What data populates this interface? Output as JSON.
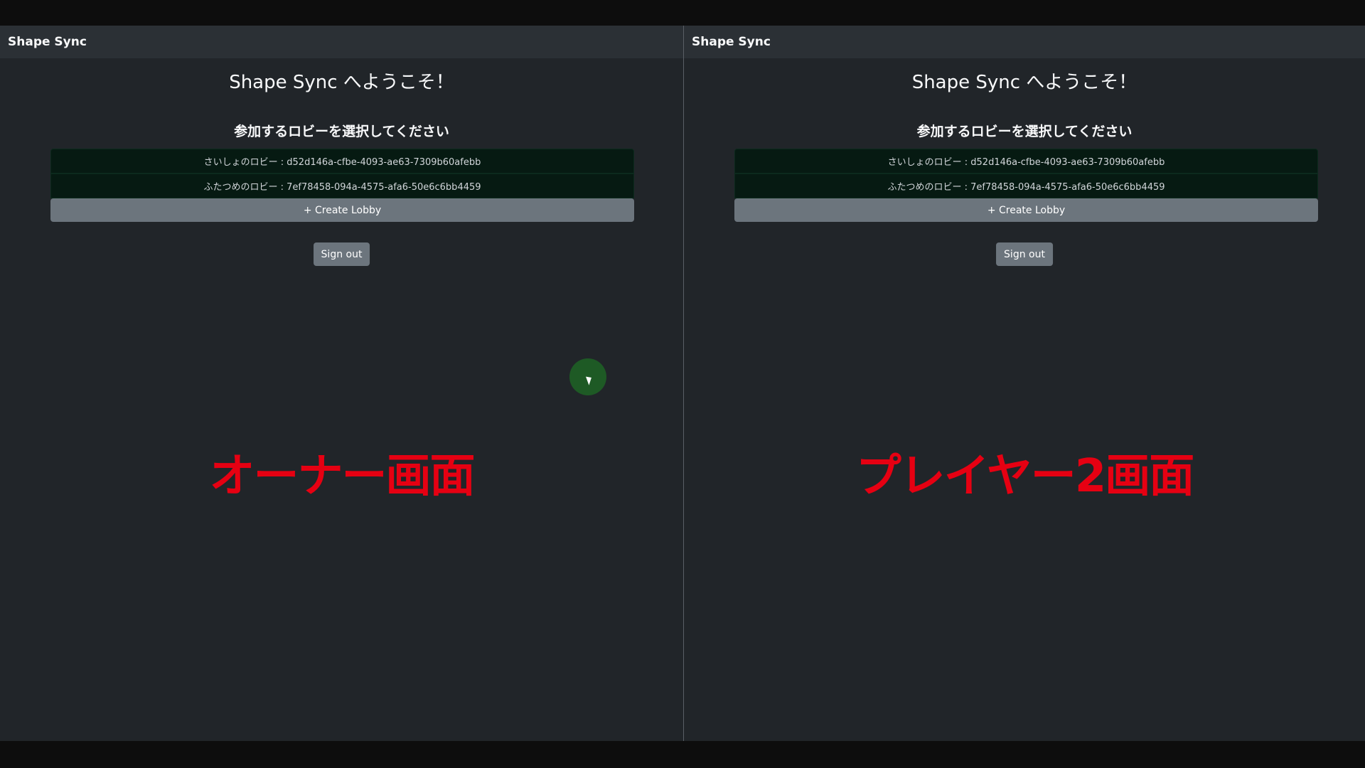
{
  "panels": [
    {
      "navbar_brand": "Shape Sync",
      "title": "Shape Sync へようこそ！",
      "subtitle": "参加するロビーを選択してください",
      "lobbies": [
        "さいしょのロビー : d52d146a-cfbe-4093-ae63-7309b60afebb",
        "ふたつめのロビー : 7ef78458-094a-4575-afa6-50e6c6bb4459"
      ],
      "create_lobby_label": "+ Create Lobby",
      "sign_out_label": "Sign out",
      "overlay_label": "オーナー画面"
    },
    {
      "navbar_brand": "Shape Sync",
      "title": "Shape Sync へようこそ！",
      "subtitle": "参加するロビーを選択してください",
      "lobbies": [
        "さいしょのロビー : d52d146a-cfbe-4093-ae63-7309b60afebb",
        "ふたつめのロビー : 7ef78458-094a-4575-afa6-50e6c6bb4459"
      ],
      "create_lobby_label": "+ Create Lobby",
      "sign_out_label": "Sign out",
      "overlay_label": "プレイヤー2画面"
    }
  ],
  "colors": {
    "background": "#212529",
    "navbar": "#2b3035",
    "lobby_item": "#061a12",
    "button": "#6c757d",
    "overlay_text": "#e60012",
    "cursor_highlight": "#1e5a25"
  },
  "icons": [
    "mouse-pointer-icon"
  ]
}
